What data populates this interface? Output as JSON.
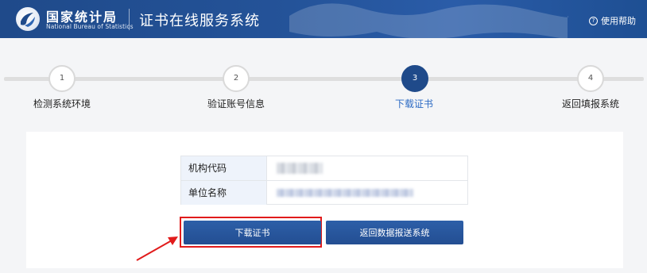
{
  "header": {
    "org_name_cn": "国家统计局",
    "org_name_en": "National Bureau of Statistics",
    "system_title": "证书在线服务系统",
    "help_label": "使用帮助"
  },
  "steps": [
    {
      "number": "1",
      "label": "检测系统环境",
      "active": false
    },
    {
      "number": "2",
      "label": "验证账号信息",
      "active": false
    },
    {
      "number": "3",
      "label": "下载证书",
      "active": true
    },
    {
      "number": "4",
      "label": "返回填报系统",
      "active": false
    }
  ],
  "info": {
    "rows": [
      {
        "label": "机构代码",
        "value": ""
      },
      {
        "label": "单位名称",
        "value": ""
      }
    ]
  },
  "buttons": {
    "download": "下载证书",
    "return": "返回数据报送系统"
  },
  "colors": {
    "brand": "#1f4a8a",
    "active_step_text": "#2d6bc4",
    "highlight": "#e11b1b"
  }
}
